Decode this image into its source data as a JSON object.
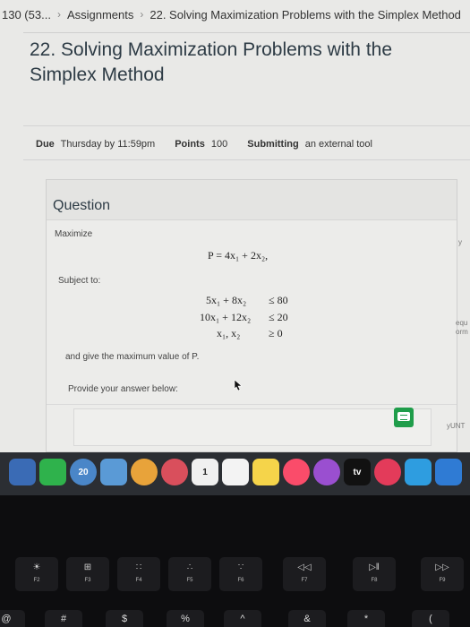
{
  "breadcrumb": {
    "course": "130 (53...",
    "assignments": "Assignments",
    "current": "22. Solving Maximization Problems with the Simplex Method"
  },
  "page": {
    "title": "22. Solving Maximization Problems with the Simplex Method"
  },
  "details": {
    "due_label": "Due",
    "due_value": "Thursday by 11:59pm",
    "points_label": "Points",
    "points_value": "100",
    "submitting_label": "Submitting",
    "submitting_value": "an external tool"
  },
  "question": {
    "header": "Question",
    "maximize_label": "Maximize",
    "objective": "P = 4x₁ + 2x₂,",
    "subject_label": "Subject to:",
    "constraints": [
      {
        "lhs": "5x₁ + 8x₂",
        "rhs": "≤ 80"
      },
      {
        "lhs": "10x₁ + 12x₂",
        "rhs": "≤ 20"
      },
      {
        "lhs": "x₁, x₂",
        "rhs": "≥ 0"
      }
    ],
    "closing_text": "and give the maximum value of P.",
    "answer_prompt": "Provide your answer below:"
  },
  "edge_fragments": {
    "a": "y",
    "b": "equ",
    "c": "orm",
    "d": "yUNT"
  },
  "dock": {
    "tv_label": "tv",
    "badge": "20",
    "calendar_day": "1"
  },
  "keyboard": {
    "fkeys": [
      {
        "label": "F2",
        "symbol": "☀"
      },
      {
        "label": "F3",
        "symbol": "⊞"
      },
      {
        "label": "F4",
        "symbol": "∷"
      },
      {
        "label": "F5",
        "symbol": "∴"
      },
      {
        "label": "F6",
        "symbol": "∵"
      },
      {
        "label": "F7",
        "symbol": "◁◁"
      },
      {
        "label": "F8",
        "symbol": "▷‖"
      },
      {
        "label": "F9",
        "symbol": "▷▷"
      }
    ],
    "number_row": [
      "@",
      "#",
      "$",
      "%",
      "^",
      "&",
      "*",
      "("
    ]
  },
  "colors": {
    "message_icon": "#1f9d4a",
    "title_text": "#2d3b45"
  }
}
